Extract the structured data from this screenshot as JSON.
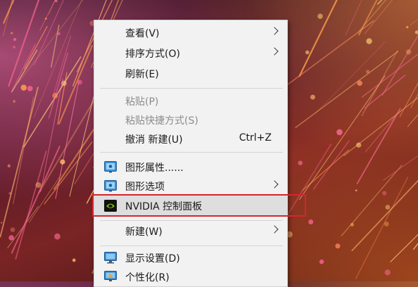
{
  "context_menu": {
    "items": {
      "view": {
        "label": "查看(V)"
      },
      "sort_by": {
        "label": "排序方式(O)"
      },
      "refresh": {
        "label": "刷新(E)"
      },
      "paste": {
        "label": "粘贴(P)"
      },
      "paste_shortcut": {
        "label": "粘贴快捷方式(S)"
      },
      "undo_new": {
        "label": "撤消 新建(U)",
        "shortcut": "Ctrl+Z"
      },
      "graphics_properties": {
        "label": "图形属性......",
        "icon": "intel-graphics-icon"
      },
      "graphics_options": {
        "label": "图形选项",
        "icon": "intel-graphics-icon"
      },
      "nvidia_control_panel": {
        "label": "NVIDIA 控制面板",
        "icon": "nvidia-icon"
      },
      "new": {
        "label": "新建(W)"
      },
      "display_settings": {
        "label": "显示设置(D)",
        "icon": "display-icon"
      },
      "personalize": {
        "label": "个性化(R)",
        "icon": "personalize-icon"
      }
    }
  },
  "colors": {
    "menu_background": "#f2f2f2",
    "highlight_background": "#dedede",
    "callout_border": "#d6242e",
    "nvidia_green": "#76b900"
  }
}
